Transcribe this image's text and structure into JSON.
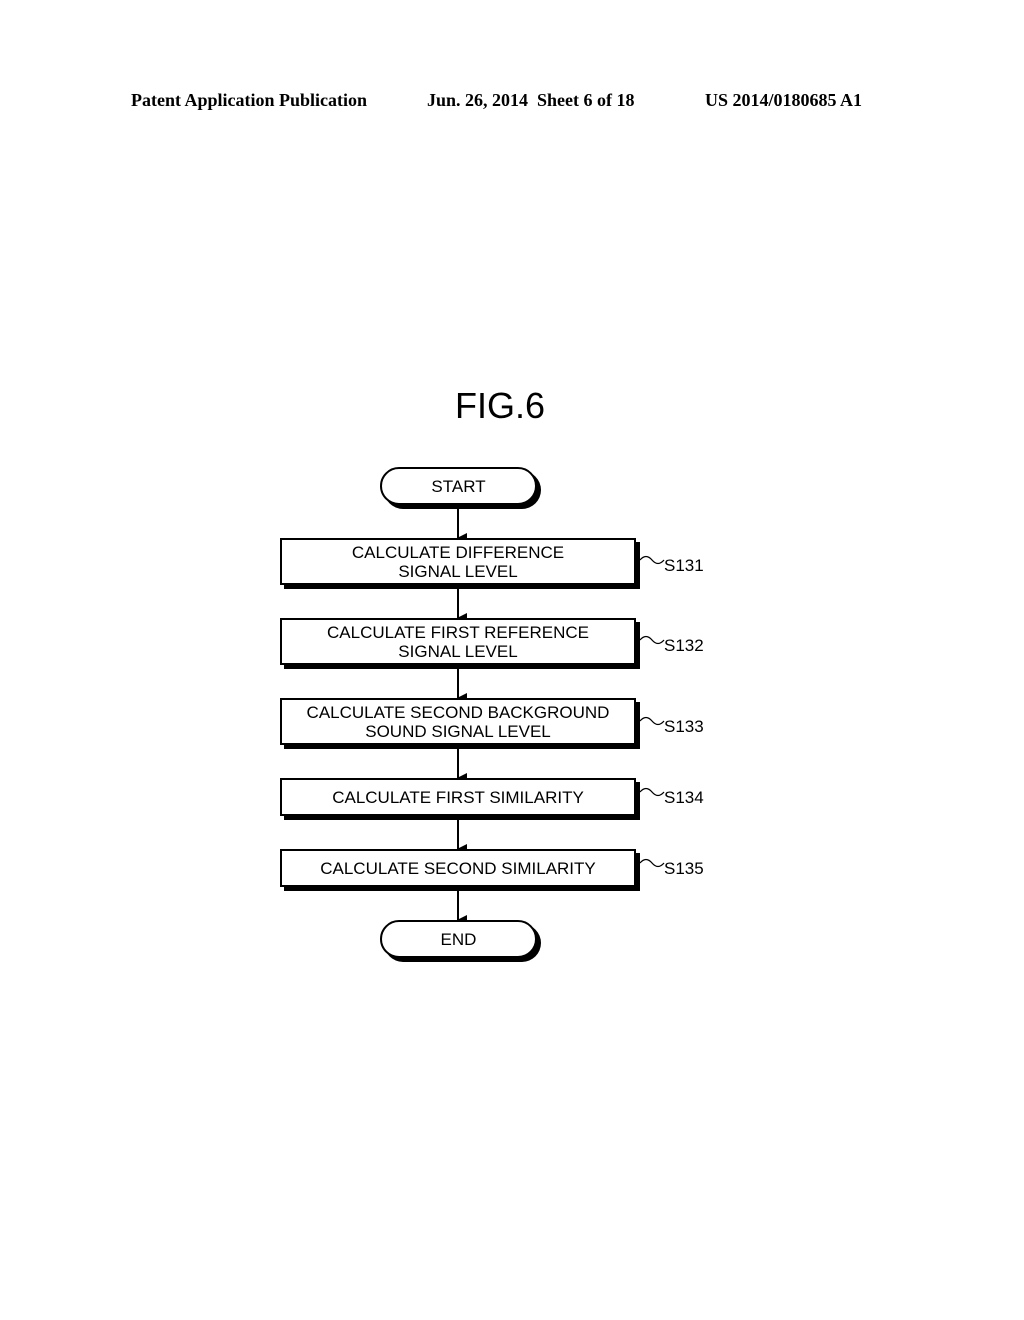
{
  "header": {
    "publication": "Patent Application Publication",
    "date_sheet": "Jun. 26, 2014  Sheet 6 of 18",
    "number": "US 2014/0180685 A1"
  },
  "figure": {
    "title": "FIG.6",
    "start": "START",
    "end": "END",
    "steps": [
      {
        "text": "CALCULATE DIFFERENCE\nSIGNAL LEVEL",
        "label": "S131"
      },
      {
        "text": "CALCULATE FIRST REFERENCE\nSIGNAL LEVEL",
        "label": "S132"
      },
      {
        "text": "CALCULATE SECOND BACKGROUND\nSOUND SIGNAL LEVEL",
        "label": "S133"
      },
      {
        "text": "CALCULATE FIRST SIMILARITY",
        "label": "S134"
      },
      {
        "text": "CALCULATE SECOND SIMILARITY",
        "label": "S135"
      }
    ]
  }
}
